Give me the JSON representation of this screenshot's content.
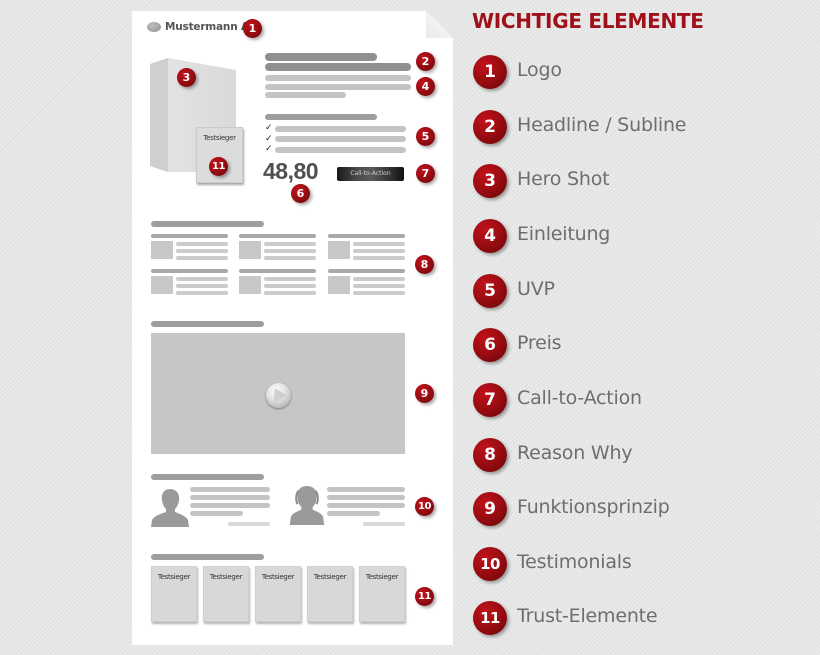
{
  "wireframe": {
    "logo_text": "Mustermann AG",
    "seal_label": "Testsieger",
    "price": "48,80",
    "cta_label": "Call-to-Action",
    "trust_labels": [
      "Testsieger",
      "Testsieger",
      "Testsieger",
      "Testsieger",
      "Testsieger"
    ],
    "markers": {
      "logo": "1",
      "headline": "2",
      "hero": "3",
      "intro": "4",
      "uvp": "5",
      "price": "6",
      "cta": "7",
      "reason_why": "8",
      "function": "9",
      "testimonials": "10",
      "trust": "11",
      "seal": "11"
    }
  },
  "legend": {
    "title": "WICHTIGE ELEMENTE",
    "items": [
      {
        "number": "1",
        "label": "Logo"
      },
      {
        "number": "2",
        "label": "Headline / Subline"
      },
      {
        "number": "3",
        "label": "Hero Shot"
      },
      {
        "number": "4",
        "label": "Einleitung"
      },
      {
        "number": "5",
        "label": "UVP"
      },
      {
        "number": "6",
        "label": "Preis"
      },
      {
        "number": "7",
        "label": "Call-to-Action"
      },
      {
        "number": "8",
        "label": "Reason Why"
      },
      {
        "number": "9",
        "label": "Funktionsprinzip"
      },
      {
        "number": "10",
        "label": "Testimonials"
      },
      {
        "number": "11",
        "label": "Trust-Elemente"
      }
    ]
  },
  "colors": {
    "accent": "#a0101a",
    "badge": "#9c0d12",
    "label_text": "#6e6e6e",
    "page": "#ffffff",
    "background": "#e6e7e7"
  }
}
